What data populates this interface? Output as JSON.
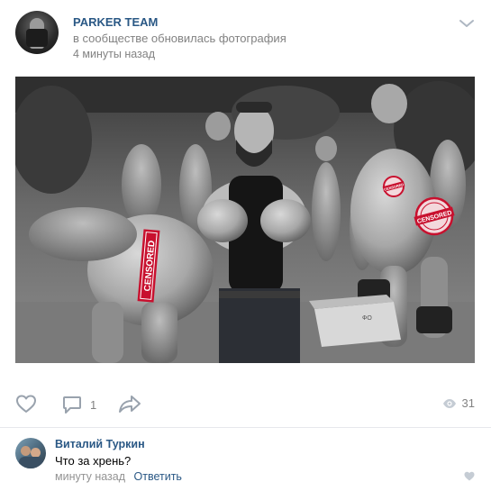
{
  "post": {
    "author": "PARKER TEAM",
    "subtitle": "в сообществе обновилась фотография",
    "time": "4 минуты назад"
  },
  "photo": {
    "stamps": [
      "CENSORED",
      "CENSORED",
      "CENSORED"
    ],
    "box_label": "ФО"
  },
  "actions": {
    "like_icon": "heart-icon",
    "comment_icon": "comment-icon",
    "comment_count": "1",
    "share_icon": "share-arrow-icon",
    "views_icon": "eye-icon",
    "views_count": "31"
  },
  "comment": {
    "author": "Виталий Туркин",
    "text": "Что за хрень?",
    "time": "минуту назад",
    "reply_label": "Ответить"
  },
  "colors": {
    "link": "#2a5885",
    "muted": "#828282",
    "icon": "#99a2ad",
    "stamp_red": "#c8102e"
  }
}
